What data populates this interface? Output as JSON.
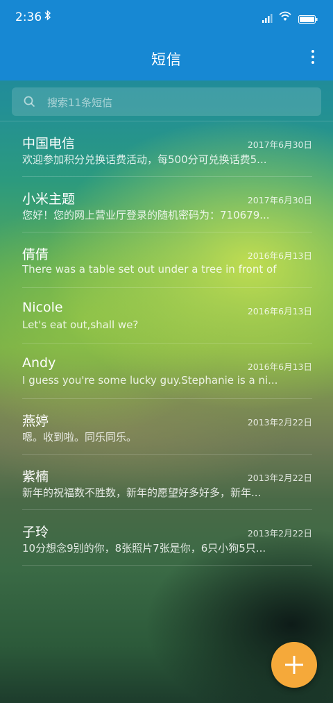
{
  "status_bar": {
    "time": "2:36"
  },
  "app_bar": {
    "title": "短信"
  },
  "search": {
    "placeholder": "搜索11条短信"
  },
  "messages": [
    {
      "sender": "中国电信",
      "date": "2017年6月30日",
      "preview": "欢迎参加积分兑换话费活动，每500分可兑换话费5..."
    },
    {
      "sender": "小米主题",
      "date": "2017年6月30日",
      "preview": "您好！您的网上营业厅登录的随机密码为：710679..."
    },
    {
      "sender": "倩倩",
      "date": "2016年6月13日",
      "preview": "There was a table set out under a tree in front of ..."
    },
    {
      "sender": "Nicole",
      "date": "2016年6月13日",
      "preview": "Let's eat out,shall we?"
    },
    {
      "sender": "Andy",
      "date": "2016年6月13日",
      "preview": "I guess you're some lucky guy.Stephanie is a ni..."
    },
    {
      "sender": "燕婷",
      "date": "2013年2月22日",
      "preview": "嗯。收到啦。同乐同乐。"
    },
    {
      "sender": "紫楠",
      "date": "2013年2月22日",
      "preview": "新年的祝福数不胜数，新年的愿望好多好多，新年..."
    },
    {
      "sender": "子玲",
      "date": "2013年2月22日",
      "preview": "10分想念9别的你，8张照片7张是你，6只小狗5只..."
    }
  ],
  "fab": {
    "icon": "plus-icon",
    "color": "#f5a93a"
  },
  "theme": {
    "accent": "#1788d3"
  }
}
